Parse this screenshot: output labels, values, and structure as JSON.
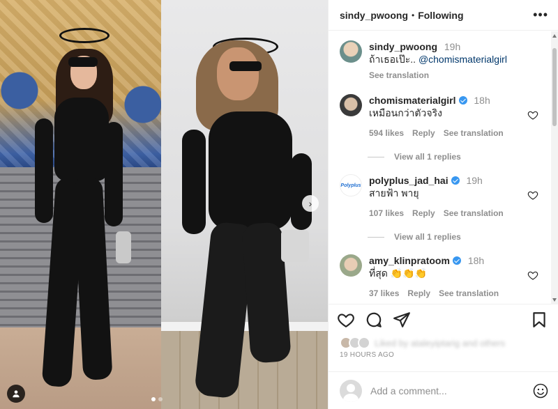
{
  "post": {
    "author": "sindy_pwoong",
    "separator": "•",
    "follow_status": "Following",
    "more": "•••",
    "caption": {
      "username": "sindy_pwoong",
      "time": "19h",
      "text": "ถ้าเธอเป๊ะ..",
      "mention": "@chomismaterialgirl",
      "translate": "See translation"
    }
  },
  "comments": [
    {
      "username": "chomismaterialgirl",
      "time": "18h",
      "text": "เหมือนกว่าตัวจริง",
      "likes": "594 likes",
      "reply": "Reply",
      "translate": "See translation",
      "view_replies": "View all 1 replies"
    },
    {
      "username": "polyplus_jad_hai",
      "time": "19h",
      "text": "สายฟ้า พายุ",
      "likes": "107 likes",
      "reply": "Reply",
      "translate": "See translation",
      "view_replies": "View all 1 replies",
      "avatar_text": "Polyplus"
    },
    {
      "username": "amy_klinpratoom",
      "time": "18h",
      "text": "ที่สุด 👏👏👏",
      "likes": "37 likes",
      "reply": "Reply",
      "translate": "See translation"
    }
  ],
  "footer": {
    "likes_text": "Liked by ataleyiptarig and others",
    "timestamp": "19 HOURS AGO",
    "add_comment_placeholder": "Add a comment..."
  },
  "media": {
    "nav_arrow": "›",
    "carousel_count": 2,
    "carousel_current": 1
  },
  "icons": [
    "heart-icon",
    "comment-icon",
    "share-icon",
    "save-icon",
    "emoji-icon",
    "user-tag-icon",
    "verified-icon"
  ]
}
